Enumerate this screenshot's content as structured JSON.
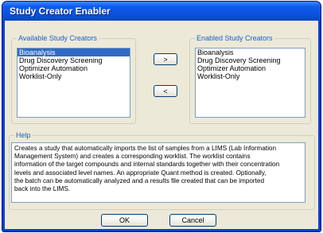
{
  "window": {
    "title": "Study Creator Enabler"
  },
  "available": {
    "label": "Available Study Creators",
    "items": [
      "Bioanalysis",
      "Drug Discovery Screening",
      "Optimizer Automation",
      "Worklist-Only"
    ],
    "selected_index": 0
  },
  "buttons": {
    "add": ">",
    "remove": "<",
    "ok": "OK",
    "cancel": "Cancel"
  },
  "enabled": {
    "label": "Enabled Study Creators",
    "items": [
      "Bioanalysis",
      "Drug Discovery Screening",
      "Optimizer Automation",
      "Worklist-Only"
    ]
  },
  "help": {
    "label": "Help",
    "lines": [
      "Creates a study that automatically imports the list of samples from a LIMS (Lab Information",
      "Management System) and creates a corresponding worklist.  The worklist contains",
      "information of the target compounds and internal standards together with their concentration",
      "levels and associated level names.  An appropriate Quant method is created.  Optionally,",
      "the batch can be automatically analyzed and a results file created that can be imported",
      "back into the LIMS."
    ]
  }
}
